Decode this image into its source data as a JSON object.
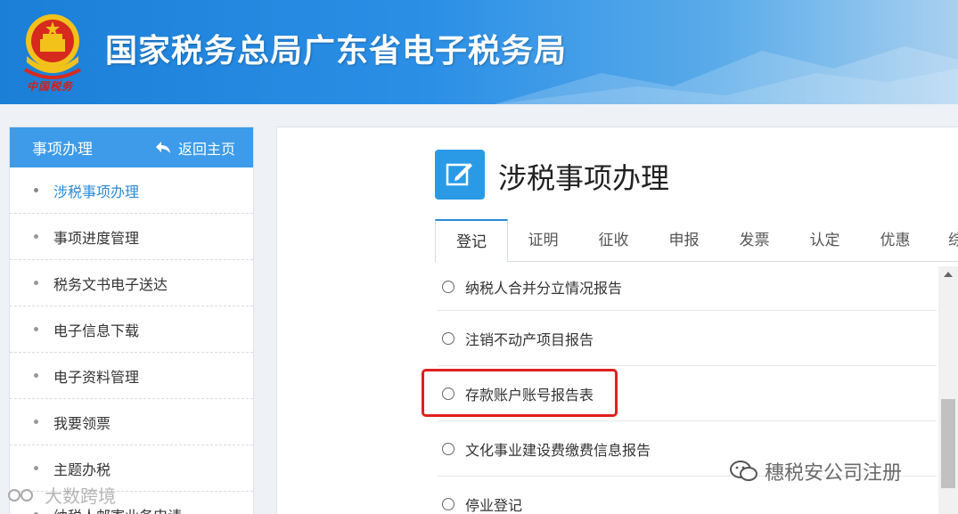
{
  "header": {
    "site_title": "国家税务总局广东省电子税务局",
    "emblem_caption": "中国税务"
  },
  "sidebar": {
    "title": "事项办理",
    "back_label": "返回主页",
    "items": [
      {
        "label": "涉税事项办理",
        "active": true
      },
      {
        "label": "事项进度管理"
      },
      {
        "label": "税务文书电子送达"
      },
      {
        "label": "电子信息下载"
      },
      {
        "label": "电子资料管理"
      },
      {
        "label": "我要领票"
      },
      {
        "label": "主题办税"
      },
      {
        "label": "纳税人邮寄业务申请"
      }
    ]
  },
  "main": {
    "title": "涉税事项办理",
    "tabs": [
      {
        "label": "登记",
        "active": true
      },
      {
        "label": "证明"
      },
      {
        "label": "征收"
      },
      {
        "label": "申报"
      },
      {
        "label": "发票"
      },
      {
        "label": "认定"
      },
      {
        "label": "优惠"
      },
      {
        "label": "综"
      }
    ],
    "options": [
      {
        "label": "纳税人合并分立情况报告"
      },
      {
        "label": "注销不动产项目报告"
      },
      {
        "label": "存款账户账号报告表",
        "highlighted": true
      },
      {
        "label": "文化事业建设费缴费信息报告"
      },
      {
        "label": "停业登记"
      }
    ]
  },
  "watermarks": {
    "right": "穗税安公司注册",
    "left": "大数跨境"
  },
  "colors": {
    "header_blue": "#1b7fd8",
    "sidebar_head": "#3d9be9",
    "active_link": "#2c8ad6",
    "highlight_red": "#e0201c"
  }
}
